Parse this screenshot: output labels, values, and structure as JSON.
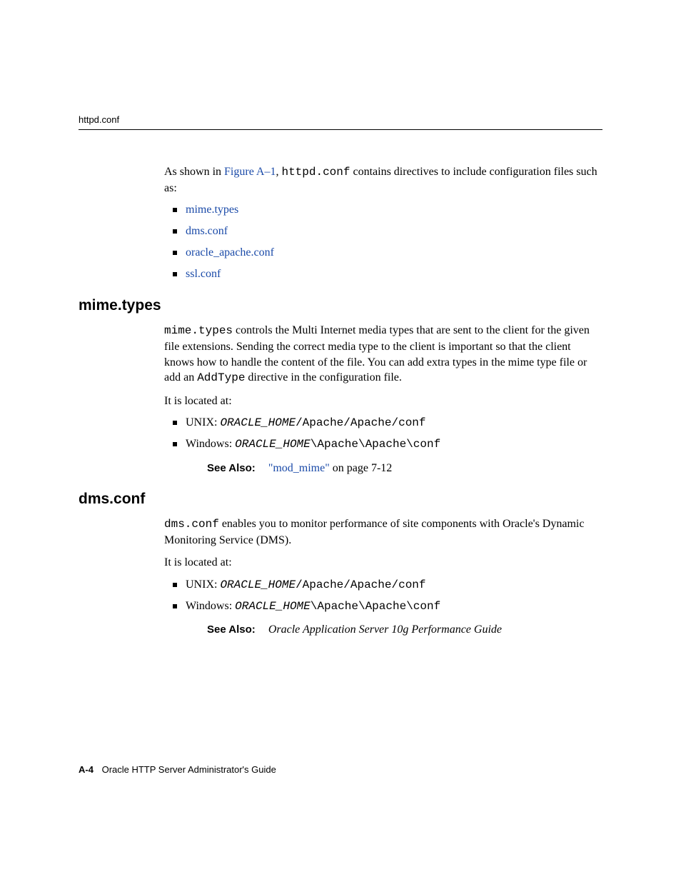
{
  "header": {
    "running_head": "httpd.conf"
  },
  "intro": {
    "pre_link": "As shown in ",
    "figure_link": "Figure A–1",
    "post_link": ", ",
    "mono": "httpd.conf",
    "tail": " contains directives to include configuration files such as:",
    "links": [
      "mime.types",
      "dms.conf",
      "oracle_apache.conf",
      "ssl.conf"
    ]
  },
  "mime": {
    "heading": "mime.types",
    "p1_mono": "mime.types",
    "p1_rest": " controls the Multi Internet media types that are sent to the client for the given file extensions. Sending the correct media type to the client is important so that the client knows how to handle the content of the file. You can add extra types in the mime type file or add an ",
    "p1_add_mono": "AddType",
    "p1_tail": " directive in the configuration file.",
    "located": "It is located at:",
    "unix_label": "UNIX: ",
    "unix_mono_i": "ORACLE_HOME",
    "unix_mono_tail": "/Apache/Apache/conf",
    "win_label": "Windows: ",
    "win_mono_i": "ORACLE_HOME",
    "win_mono_tail": "\\Apache\\Apache\\conf",
    "see_label": "See Also:",
    "see_link": "\"mod_mime\"",
    "see_tail": " on page 7-12"
  },
  "dms": {
    "heading": "dms.conf",
    "p1_mono": "dms.conf",
    "p1_rest": " enables you to monitor performance of site components with Oracle's Dynamic Monitoring Service (DMS).",
    "located": "It is located at:",
    "unix_label": "UNIX: ",
    "unix_mono_i": "ORACLE_HOME",
    "unix_mono_tail": "/Apache/Apache/conf",
    "win_label": "Windows: ",
    "win_mono_i": "ORACLE_HOME",
    "win_mono_tail": "\\Apache\\Apache\\conf",
    "see_label": "See Also:",
    "see_italic": "Oracle Application Server 10g Performance Guide"
  },
  "footer": {
    "page_num": "A-4",
    "title": "Oracle HTTP Server Administrator's Guide"
  }
}
